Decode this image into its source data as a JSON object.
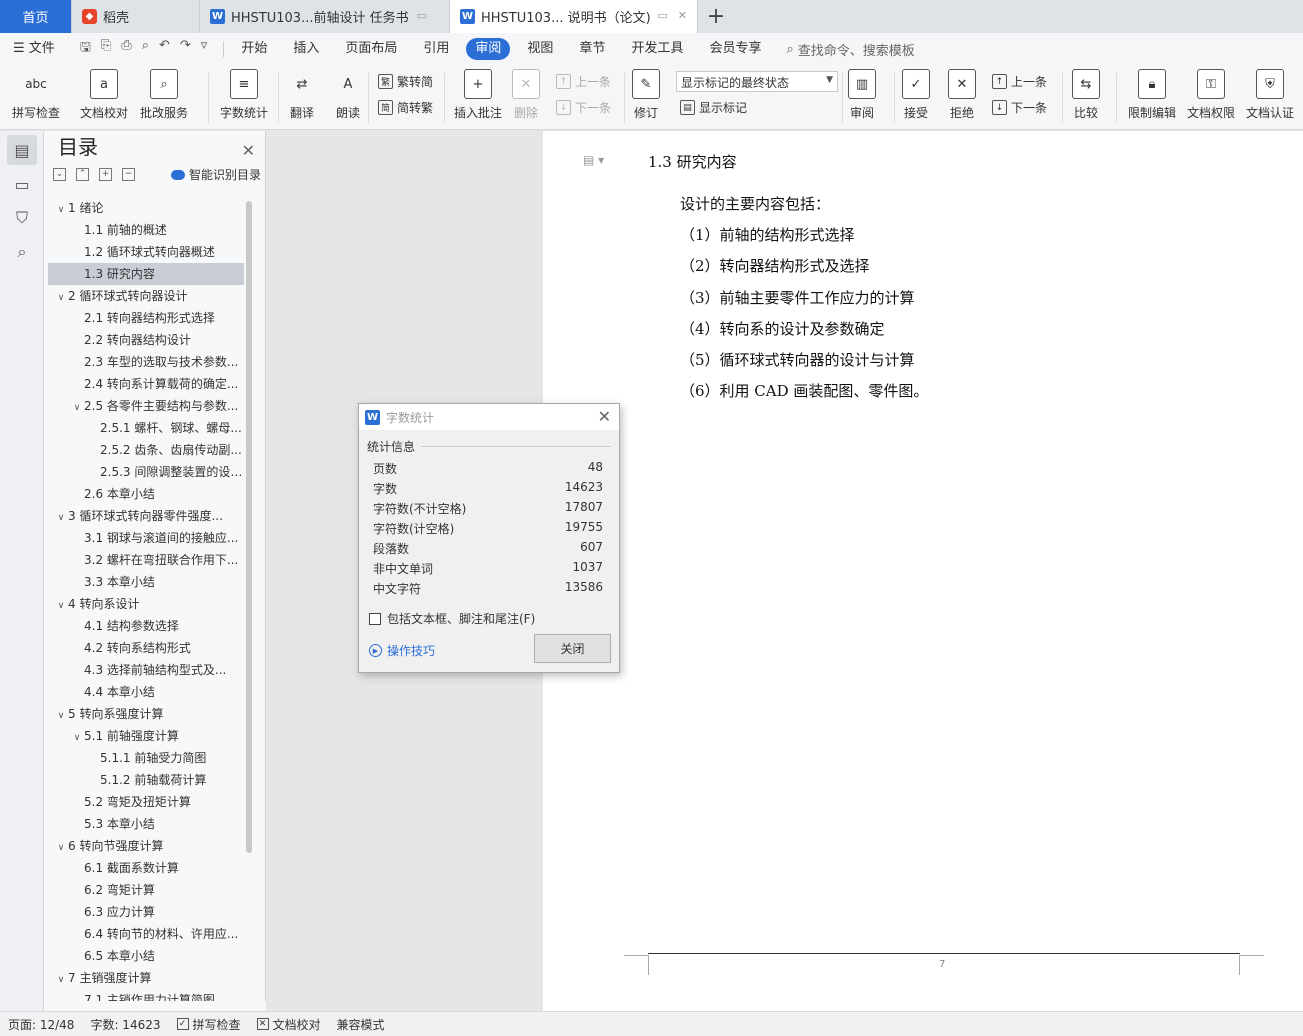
{
  "tabs": {
    "home": "首页",
    "daoke": "稻壳",
    "doc1": "HHSTU103...前轴设计 任务书",
    "doc2": "HHSTU103... 说明书（论文)",
    "new_tab": "+"
  },
  "menu": {
    "file": "文件",
    "items": [
      "开始",
      "插入",
      "页面布局",
      "引用",
      "审阅",
      "视图",
      "章节",
      "开发工具",
      "会员专享"
    ],
    "search": "查找命令、搜索模板"
  },
  "ribbon": {
    "spellcheck": "拼写检查",
    "doccheck": "文档校对",
    "review_service": "批改服务",
    "wordcount": "字数统计",
    "translate": "翻译",
    "read": "朗读",
    "trad_to_simp": "繁转简",
    "simp_to_trad": "简转繁",
    "insert_comment": "插入批注",
    "delete": "删除",
    "prev": "上一条",
    "next": "下一条",
    "revise": "修订",
    "markup_state": "显示标记的最终状态",
    "show_markup": "显示标记",
    "review": "审阅",
    "accept": "接受",
    "reject": "拒绝",
    "prev2": "上一条",
    "next2": "下一条",
    "compare": "比较",
    "restrict_edit": "限制编辑",
    "doc_permission": "文档权限",
    "doc_cert": "文档认证",
    "icon_abc": "abc"
  },
  "toc": {
    "title": "目录",
    "smart": "智能识别目录",
    "items": [
      {
        "t": "1  绪论",
        "lvl": 1,
        "exp": "v"
      },
      {
        "t": "1.1 前轴的概述",
        "lvl": 2
      },
      {
        "t": "1.2  循环球式转向器概述",
        "lvl": 2
      },
      {
        "t": "1.3  研究内容",
        "lvl": 2,
        "sel": true
      },
      {
        "t": "2  循环球式转向器设计",
        "lvl": 1,
        "exp": "v"
      },
      {
        "t": "2.1  转向器结构形式选择",
        "lvl": 2
      },
      {
        "t": "2.2  转向器结构设计",
        "lvl": 2
      },
      {
        "t": "2.3 车型的选取与技术参数...",
        "lvl": 2
      },
      {
        "t": "2.4  转向系计算载荷的确定...",
        "lvl": 2
      },
      {
        "t": "2.5 各零件主要结构与参数...",
        "lvl": 2,
        "exp": "v"
      },
      {
        "t": "2.5.1  螺杆、钢球、螺母...",
        "lvl": 3
      },
      {
        "t": "2.5.2  齿条、齿扇传动副...",
        "lvl": 3
      },
      {
        "t": "2.5.3  间隙调整装置的设计...",
        "lvl": 3
      },
      {
        "t": "2.6  本章小结",
        "lvl": 2
      },
      {
        "t": "3  循环球式转向器零件强度...",
        "lvl": 1,
        "exp": "v"
      },
      {
        "t": "3.1  钢球与滚道间的接触应...",
        "lvl": 2
      },
      {
        "t": "3.2  螺杆在弯扭联合作用下...",
        "lvl": 2
      },
      {
        "t": "3.3  本章小结",
        "lvl": 2
      },
      {
        "t": "4  转向系设计",
        "lvl": 1,
        "exp": "v"
      },
      {
        "t": "4.1  结构参数选择",
        "lvl": 2
      },
      {
        "t": "4.2  转向系结构形式",
        "lvl": 2
      },
      {
        "t": "4.3  选择前轴结构型式及...",
        "lvl": 2
      },
      {
        "t": "4.4  本章小结",
        "lvl": 2
      },
      {
        "t": "5  转向系强度计算",
        "lvl": 1,
        "exp": "v"
      },
      {
        "t": "5.1  前轴强度计算",
        "lvl": 2,
        "exp": "v"
      },
      {
        "t": "5.1.1  前轴受力简图",
        "lvl": 3
      },
      {
        "t": "5.1.2  前轴载荷计算",
        "lvl": 3
      },
      {
        "t": "5.2  弯矩及扭矩计算",
        "lvl": 2
      },
      {
        "t": "5.3  本章小结",
        "lvl": 2
      },
      {
        "t": "6  转向节强度计算",
        "lvl": 1,
        "exp": "v"
      },
      {
        "t": "6.1  截面系数计算",
        "lvl": 2
      },
      {
        "t": "6.2  弯矩计算",
        "lvl": 2
      },
      {
        "t": "6.3  应力计算",
        "lvl": 2
      },
      {
        "t": "6.4  转向节的材料、许用应...",
        "lvl": 2
      },
      {
        "t": "6.5  本章小结",
        "lvl": 2
      },
      {
        "t": "7  主销强度计算",
        "lvl": 1,
        "exp": "v"
      },
      {
        "t": "7.1  主销作用力计算简图",
        "lvl": 2
      }
    ]
  },
  "doc": {
    "heading": "1.3  研究内容",
    "lines": [
      "设计的主要内容包括：",
      "（1）前轴的结构形式选择",
      "（2）转向器结构形式及选择",
      "（3）前轴主要零件工作应力的计算",
      "（4）转向系的设计及参数确定",
      "（5）循环球式转向器的设计与计算",
      "（6）利用 CAD 画装配图、零件图。"
    ],
    "page_num": "7"
  },
  "dialog": {
    "title": "字数统计",
    "group": "统计信息",
    "rows": [
      {
        "k": "页数",
        "v": "48"
      },
      {
        "k": "字数",
        "v": "14623"
      },
      {
        "k": "字符数(不计空格)",
        "v": "17807"
      },
      {
        "k": "字符数(计空格)",
        "v": "19755"
      },
      {
        "k": "段落数",
        "v": "607"
      },
      {
        "k": "非中文单词",
        "v": "1037"
      },
      {
        "k": "中文字符",
        "v": "13586"
      }
    ],
    "checkbox": "包括文本框、脚注和尾注(F)",
    "tips": "操作技巧",
    "close": "关闭"
  },
  "status": {
    "page": "页面: 12/48",
    "words": "字数: 14623",
    "spell": "拼写检查",
    "proof": "文档校对",
    "compat": "兼容模式"
  },
  "colors": {
    "accent": "#2b6fd6",
    "daoke": "#e8442c"
  }
}
